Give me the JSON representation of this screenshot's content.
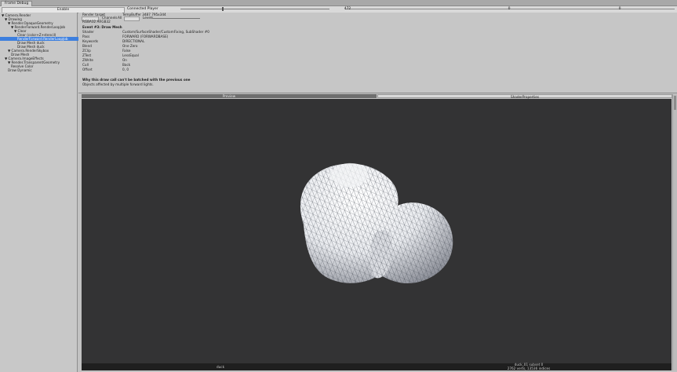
{
  "window": {
    "tab_title": "Frame Debug"
  },
  "toolbar": {
    "enable_label": "Enable",
    "connected_label": "Connected Player",
    "count_a": "472",
    "count_b": "0",
    "count_c": "0"
  },
  "tree": [
    {
      "label": "▼ Camera.Render",
      "indent": 0
    },
    {
      "label": "▼ Drawing",
      "indent": 1
    },
    {
      "label": "▼ Render.OpaqueGeometry",
      "indent": 2
    },
    {
      "label": "▼ RenderForward.RenderLoopJob",
      "indent": 3
    },
    {
      "label": "▼ Clear",
      "indent": 4
    },
    {
      "label": "Clear (color+Z+stencil)",
      "indent": 5
    },
    {
      "label": "RenderForward.RenderLoopJob",
      "indent": 5,
      "selected": true
    },
    {
      "label": "Draw Mesh duck",
      "indent": 5
    },
    {
      "label": "Draw Mesh duck",
      "indent": 5
    },
    {
      "label": "▼ Camera.RenderSkybox",
      "indent": 2
    },
    {
      "label": "Draw Mesh",
      "indent": 3
    },
    {
      "label": "▼ Camera.ImageEffects",
      "indent": 1
    },
    {
      "label": "▼ Render.TransparentGeometry",
      "indent": 2
    },
    {
      "label": "Resolve Color",
      "indent": 3
    },
    {
      "label": "Draw Dynamic",
      "indent": 2
    }
  ],
  "details": {
    "render_target_label": "Render target",
    "render_target_value": "TempBuffer 3487 795x344",
    "channels_label": "Channels",
    "channels_value": "All",
    "levels_label": "Levels",
    "rt_format": "RGBA32 ARGB32",
    "event_title": "Event #3: Draw Mesh",
    "props": [
      {
        "key": "Shader",
        "value": "Custom/SurfaceShader/CustomFixing, SubShader #0"
      },
      {
        "key": "Pass",
        "value": "FORWARD (FORWARDBASE)"
      },
      {
        "key": "Keywords",
        "value": "DIRECTIONAL"
      },
      {
        "key": "Blend",
        "value": "One Zero"
      },
      {
        "key": "ZClip",
        "value": "False"
      },
      {
        "key": "ZTest",
        "value": "LessEqual"
      },
      {
        "key": "ZWrite",
        "value": "On"
      },
      {
        "key": "Cull",
        "value": "Back"
      },
      {
        "key": "Offset",
        "value": "0, 0"
      }
    ],
    "batch_title": "Why this draw call can't be batched with the previous one",
    "batch_reason": "Objects affected by multiple forward lights."
  },
  "preview_tabs": {
    "preview": "Preview",
    "shader_properties": "ShaderProperties"
  },
  "viewport": {
    "mesh_name": "duck",
    "subset_line1": "duck_01 subset 0",
    "subset_line2": "2762 verts, 13536 indices",
    "background": "#333334"
  },
  "colors": {
    "selection": "#3d7fde",
    "panel": "#c6c6c6"
  }
}
